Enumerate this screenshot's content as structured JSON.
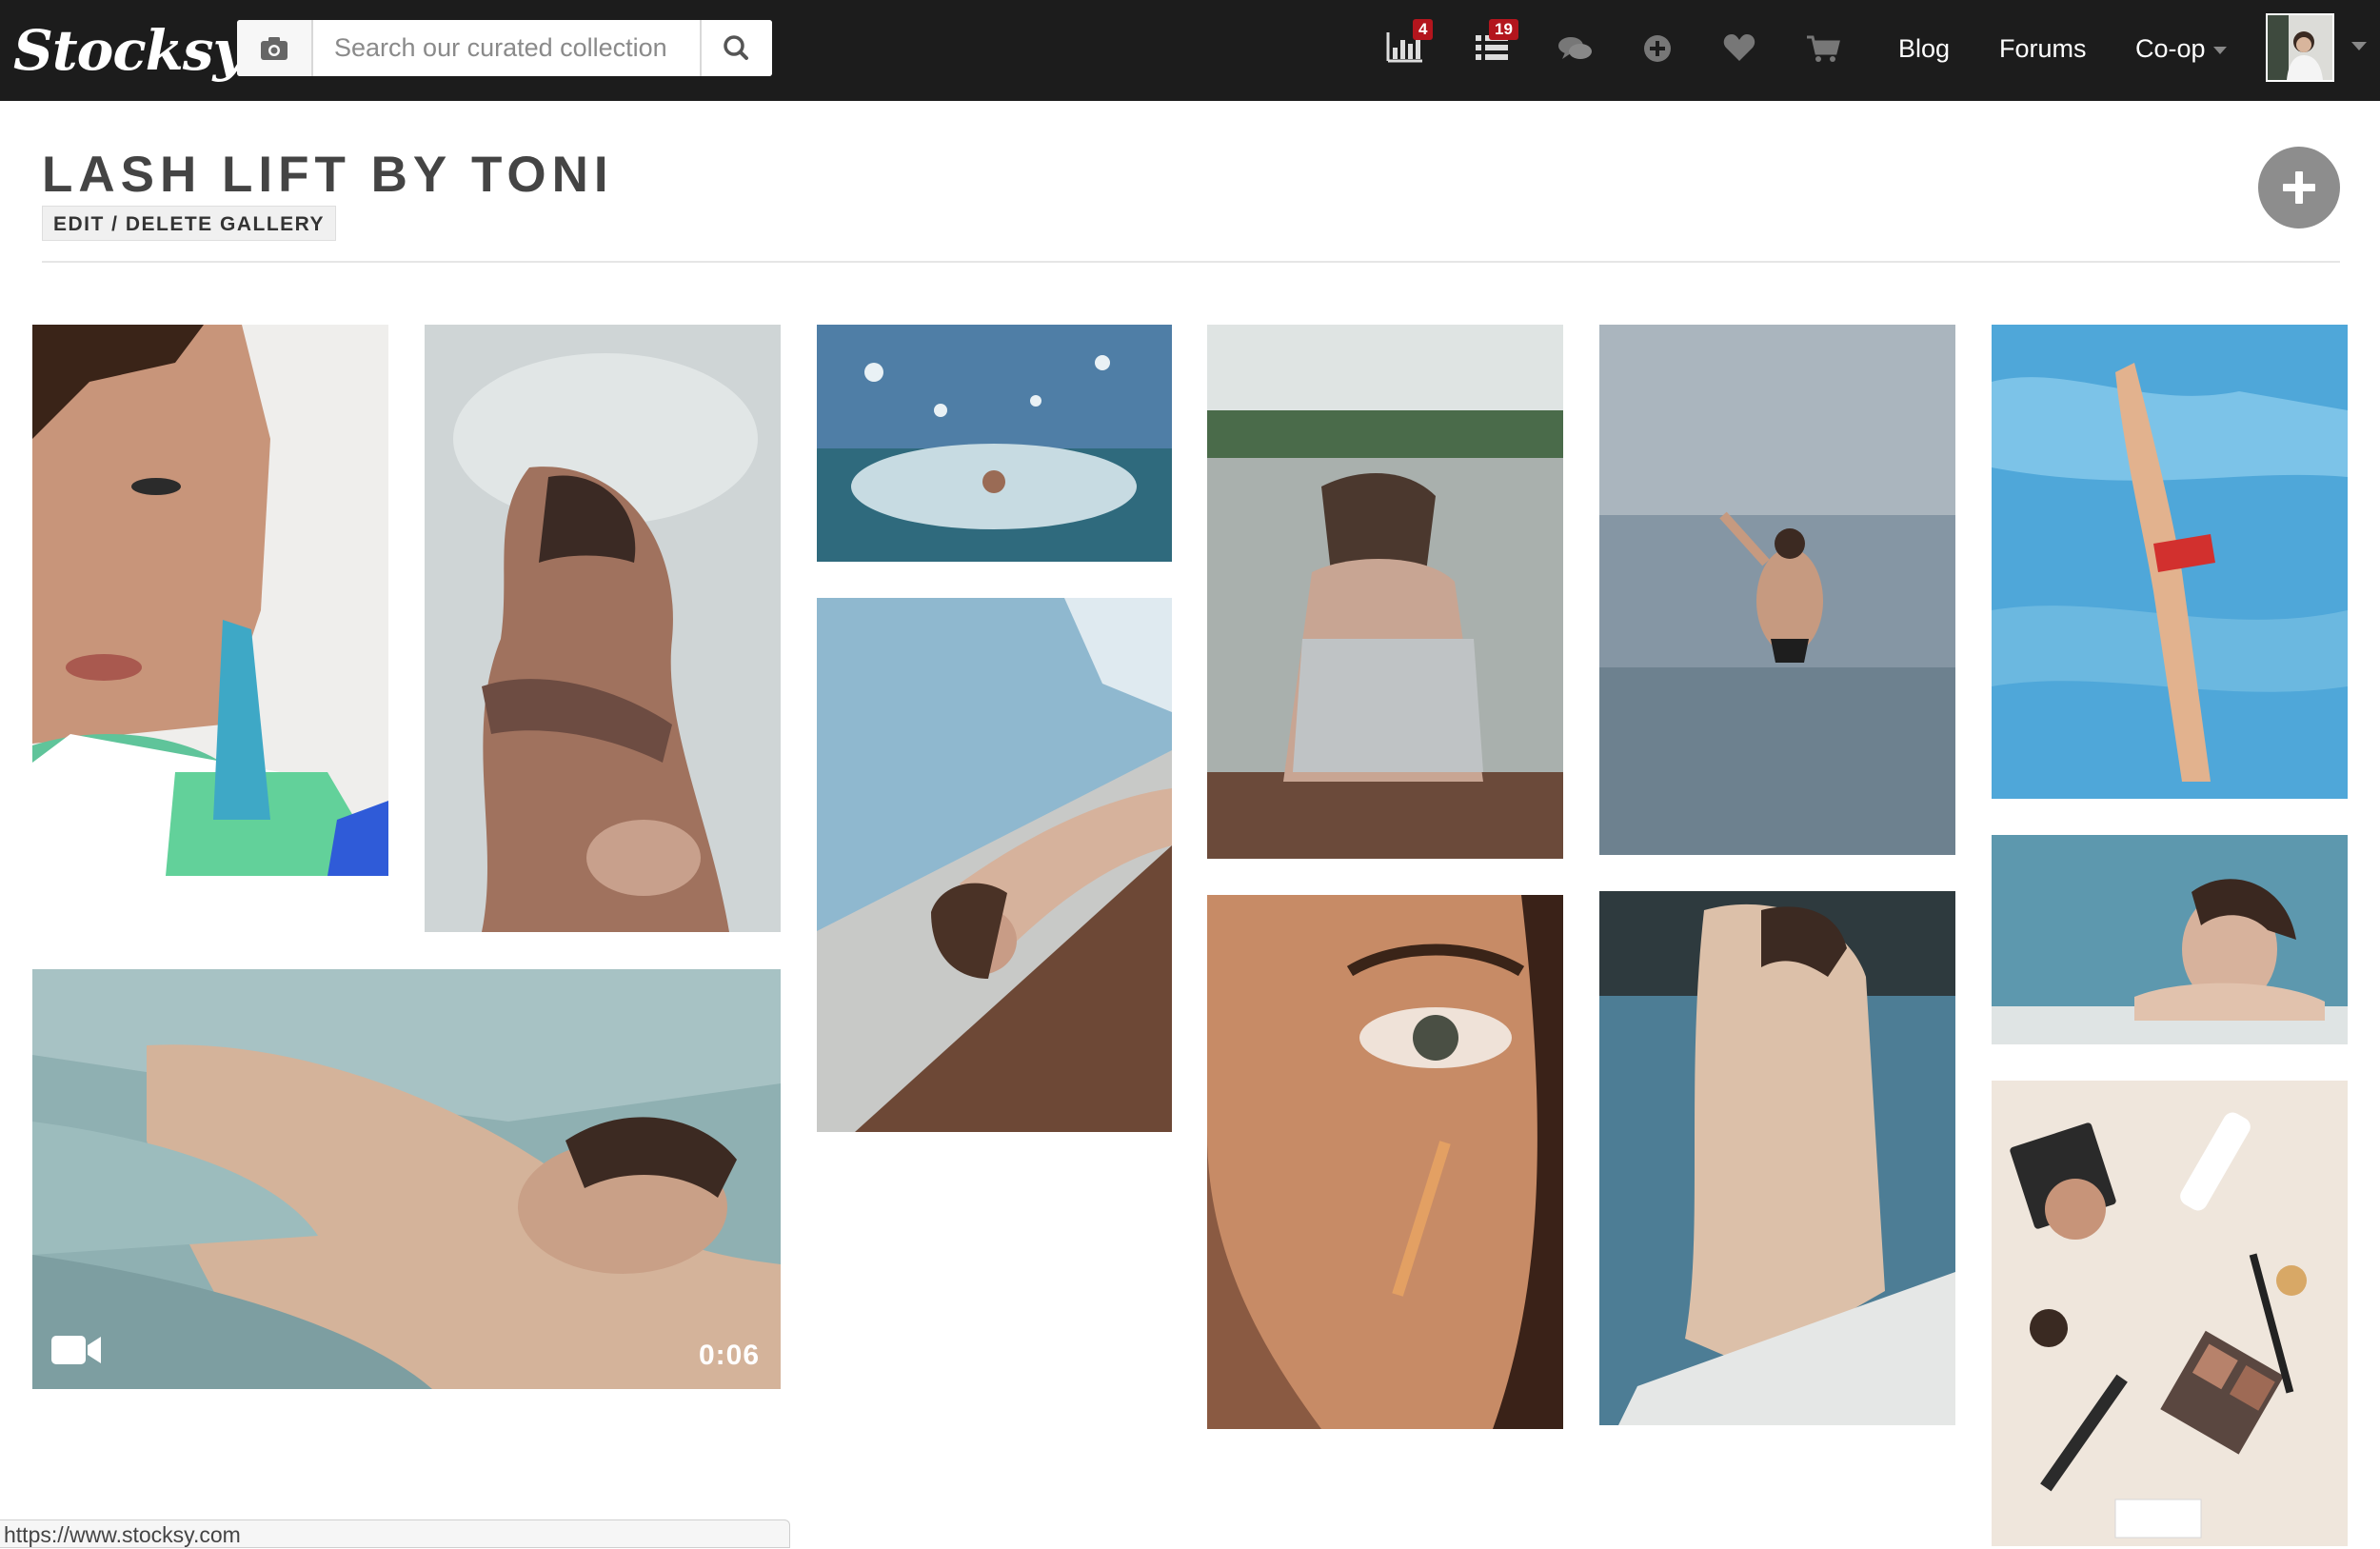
{
  "app": {
    "logo_text": "Stocksy"
  },
  "search": {
    "placeholder": "Search our curated collection",
    "value": ""
  },
  "nav": {
    "stats_badge": "4",
    "lists_badge": "19",
    "links": {
      "blog": "Blog",
      "forums": "Forums",
      "coop": "Co-op"
    }
  },
  "gallery": {
    "title": "LASH LIFT BY TONI",
    "edit_label": "EDIT / DELETE GALLERY"
  },
  "video": {
    "duration": "0:06"
  },
  "status_bar": {
    "url": "https://www.stocksy.com"
  },
  "colors": {
    "topbar": "#1c1c1c",
    "badge": "#b3151d",
    "add_button": "#8d8d8d"
  }
}
